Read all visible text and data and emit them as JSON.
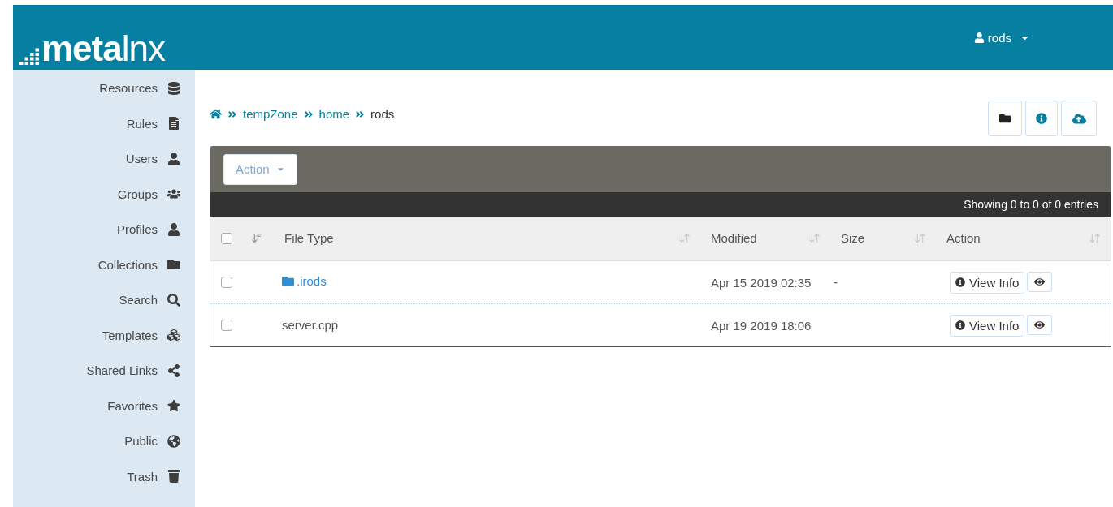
{
  "header": {
    "logo": "**meta**lnx",
    "user_menu": {
      "label": "rods"
    }
  },
  "sidebar": {
    "items": [
      {
        "label": "Resources"
      },
      {
        "label": "Rules"
      },
      {
        "label": "Users"
      },
      {
        "label": "Groups"
      },
      {
        "label": "Profiles"
      },
      {
        "label": "Collections"
      },
      {
        "label": "Search"
      },
      {
        "label": "Templates"
      },
      {
        "label": "Shared Links"
      },
      {
        "label": "Favorites"
      },
      {
        "label": "Public"
      },
      {
        "label": "Trash"
      }
    ]
  },
  "breadcrumb": [
    {
      "label": "tempZone",
      "kind": "link"
    },
    {
      "label": "home",
      "kind": "link"
    },
    {
      "label": "rods",
      "kind": "current"
    }
  ],
  "table": {
    "action_button": {
      "label": "Action",
      "disabled": true
    },
    "info": "Showing 0 to 0 of 0 entries",
    "select_all": {
      "checked": false
    },
    "columns": [
      "File Type",
      "Modified",
      "Size",
      "Action"
    ],
    "rows": [
      {
        "checked": false,
        "kind": "folder",
        "name": ".irods",
        "modified": "Apr 15 2019 02:35",
        "size": "-",
        "action": "View Info"
      },
      {
        "checked": false,
        "kind": "file",
        "name": "server.cpp",
        "modified": "Apr 19 2019 18:06",
        "action": "View Info"
      }
    ]
  }
}
